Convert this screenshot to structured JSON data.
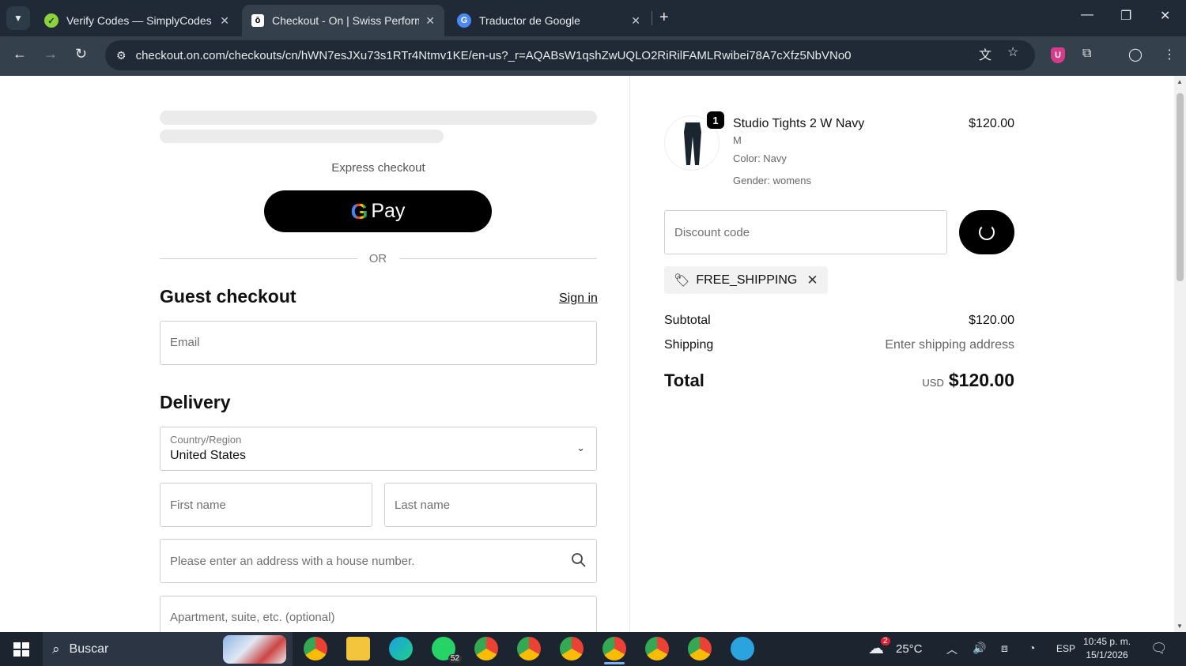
{
  "browser": {
    "tabs": [
      {
        "title": "Verify Codes — SimplyCodes",
        "active": false
      },
      {
        "title": "Checkout - On | Swiss Performa",
        "active": true
      },
      {
        "title": "Traductor de Google",
        "active": false
      }
    ],
    "url": "checkout.on.com/checkouts/cn/hWN7esJXu73s1RTr4Ntmv1KE/en-us?_r=AQABsW1qshZwUQLO2RiRilFAMLRwibei78A7cXfz5NbVNo0"
  },
  "checkout": {
    "express_label": "Express checkout",
    "gpay_g": "G",
    "gpay_label": "Pay",
    "or_label": "OR",
    "guest_heading": "Guest checkout",
    "sign_in": "Sign in",
    "email_placeholder": "Email",
    "delivery_heading": "Delivery",
    "country_label": "Country/Region",
    "country_value": "United States",
    "first_name_placeholder": "First name",
    "last_name_placeholder": "Last name",
    "address_placeholder": "Please enter an address with a house number.",
    "apartment_placeholder": "Apartment, suite, etc. (optional)"
  },
  "summary": {
    "product": {
      "name": "Studio Tights 2 W Navy",
      "size": "M",
      "color": "Color: Navy",
      "gender": "Gender: womens",
      "price": "$120.00",
      "quantity": "1"
    },
    "discount_placeholder": "Discount code",
    "applied_code": "FREE_SHIPPING",
    "subtotal_label": "Subtotal",
    "subtotal_value": "$120.00",
    "shipping_label": "Shipping",
    "shipping_value": "Enter shipping address",
    "total_label": "Total",
    "total_currency": "USD",
    "total_value": "$120.00"
  },
  "taskbar": {
    "search_label": "Buscar",
    "whatsapp_badge": "52",
    "weather_badge": "2",
    "temperature": "25°C",
    "language": "ESP",
    "time": "10:45 p. m.",
    "date": "15/1/2026"
  },
  "colors": {
    "tabbar_bg": "#1f2a36",
    "toolbar_bg": "#35404d",
    "button_black": "#000000",
    "chip_bg": "#f2f2f2"
  }
}
